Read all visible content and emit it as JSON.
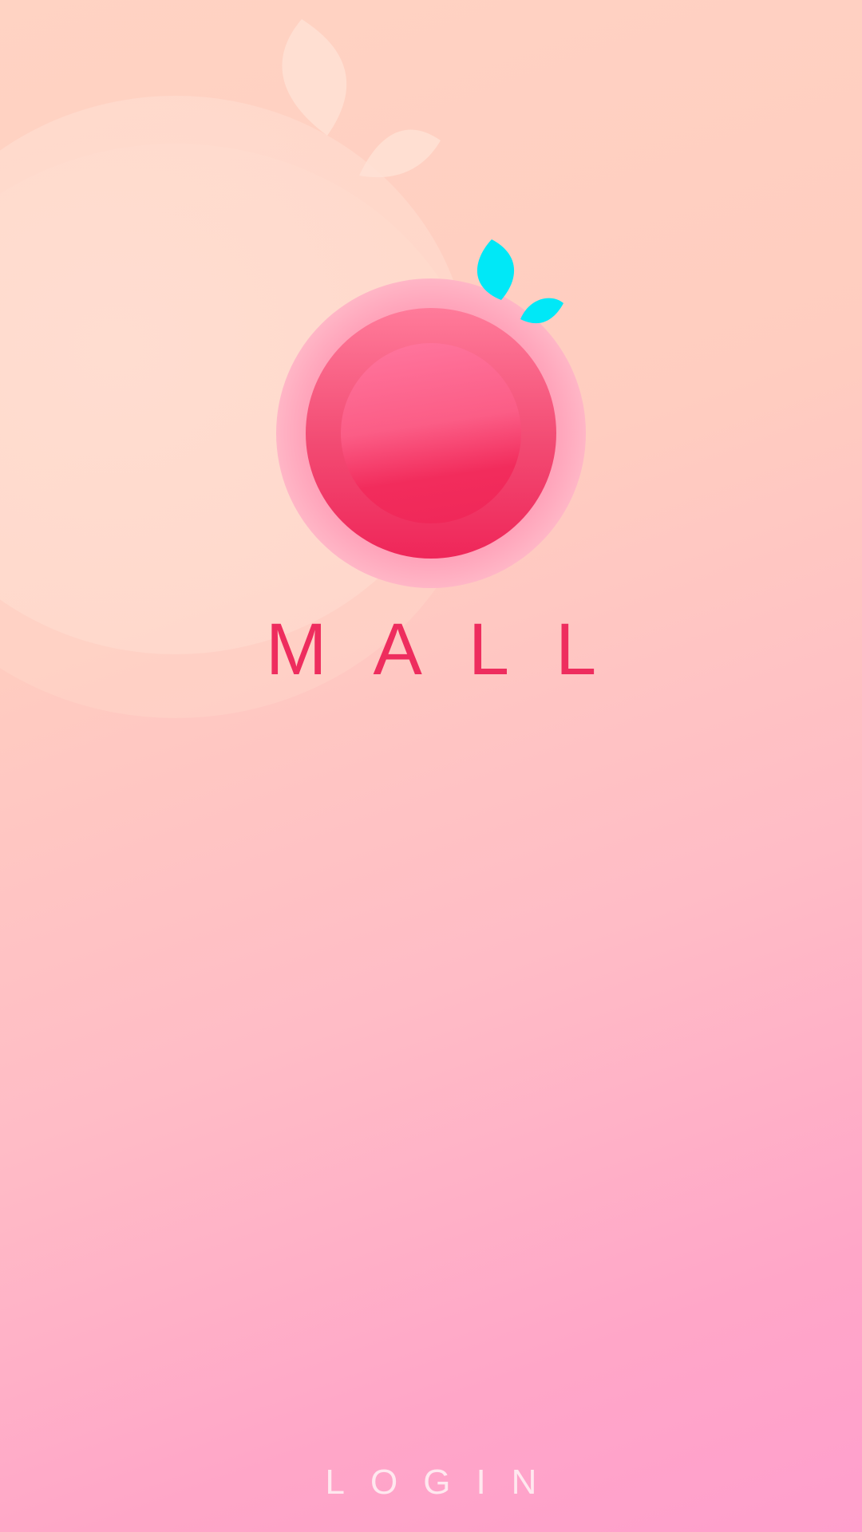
{
  "app": {
    "brand_name": "MALL",
    "login_label": "LOGIN"
  },
  "colors": {
    "brand_text": "#ee2d5e",
    "fruit_dark": "#f0285a",
    "fruit_light": "#ff7fa3",
    "fruit_halo": "#ffb3c6",
    "leaf": "#00e8f7",
    "login_text": "#ffe8ef"
  },
  "icons": {
    "logo": "fruit-logo-icon",
    "leaf": "leaf-icon",
    "background": "watermark-fruit-icon"
  }
}
